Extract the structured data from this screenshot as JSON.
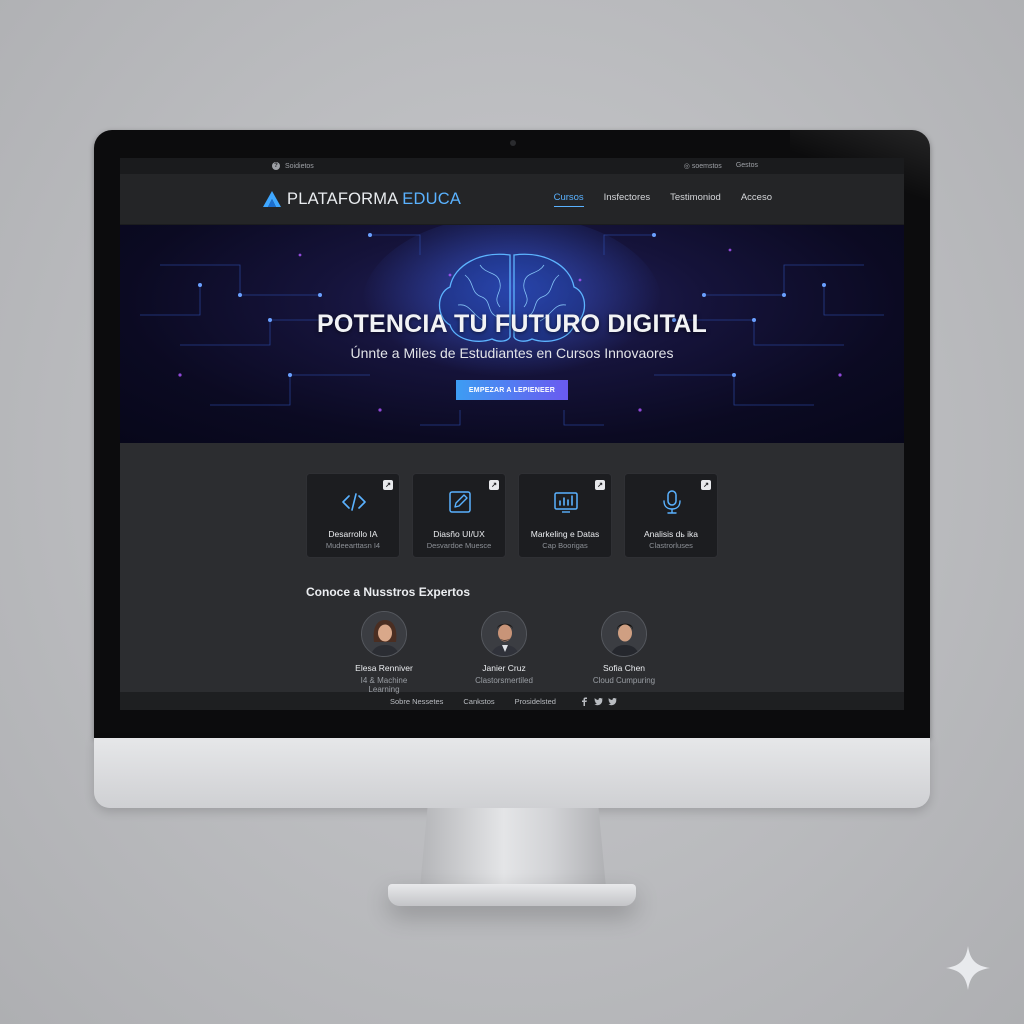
{
  "topbar": {
    "left_icon": "question-icon",
    "left_text": "Soidietos",
    "right_items": [
      "◎ soemstos",
      "Gestos"
    ]
  },
  "brand": {
    "name_main": "PLATAFORMA",
    "name_accent": "EDUCA",
    "logo_icon": "triangle-logo-icon"
  },
  "nav": {
    "items": [
      {
        "label": "Cursos",
        "active": true
      },
      {
        "label": "Insfectores",
        "active": false
      },
      {
        "label": "Testimoniod",
        "active": false
      },
      {
        "label": "Acceso",
        "active": false
      }
    ],
    "accent_color": "#5ab2ff"
  },
  "hero": {
    "title": "POTENCIA TU FUTURO DIGITAL",
    "subtitle": "Únnte a Miles de Estudiantes en Cursos Innovaores",
    "cta_label": "EMPEZAR A LEPIENEER",
    "image_icon": "neural-brain-illustration"
  },
  "cards": [
    {
      "title": "Desarrollo IA",
      "subtitle": "Mudeearttasn I4",
      "icon": "code-icon",
      "badge": "↗"
    },
    {
      "title": "Diasño UI/UX",
      "subtitle": "Desvardoe Muesce",
      "icon": "design-edit-icon",
      "badge": "↗"
    },
    {
      "title": "Markeling e Datas",
      "subtitle": "Cap Boorigas",
      "icon": "analytics-chart-icon",
      "badge": "↗"
    },
    {
      "title": "Analisis dь ika",
      "subtitle": "Clastrorluses",
      "icon": "microphone-icon",
      "badge": "↗"
    }
  ],
  "experts": {
    "title": "Conoce a Nusstros Expertos",
    "people": [
      {
        "name": "Elesa Renniver",
        "role": "I4 & Machine Learning"
      },
      {
        "name": "Janier Cruz",
        "role": "Clastorsmertiled"
      },
      {
        "name": "Sofia Chen",
        "role": "Cloud Cumpuring"
      }
    ]
  },
  "footer": {
    "links": [
      "Sobre Nessetes",
      "Cankstos",
      "Prosidelsted"
    ],
    "social_icons": [
      "facebook-icon",
      "twitter-icon",
      "twitter-icon"
    ]
  },
  "colors": {
    "brand_accent": "#5ab2ff",
    "cta_gradient_start": "#3d9df3",
    "cta_gradient_end": "#6a5af0"
  }
}
